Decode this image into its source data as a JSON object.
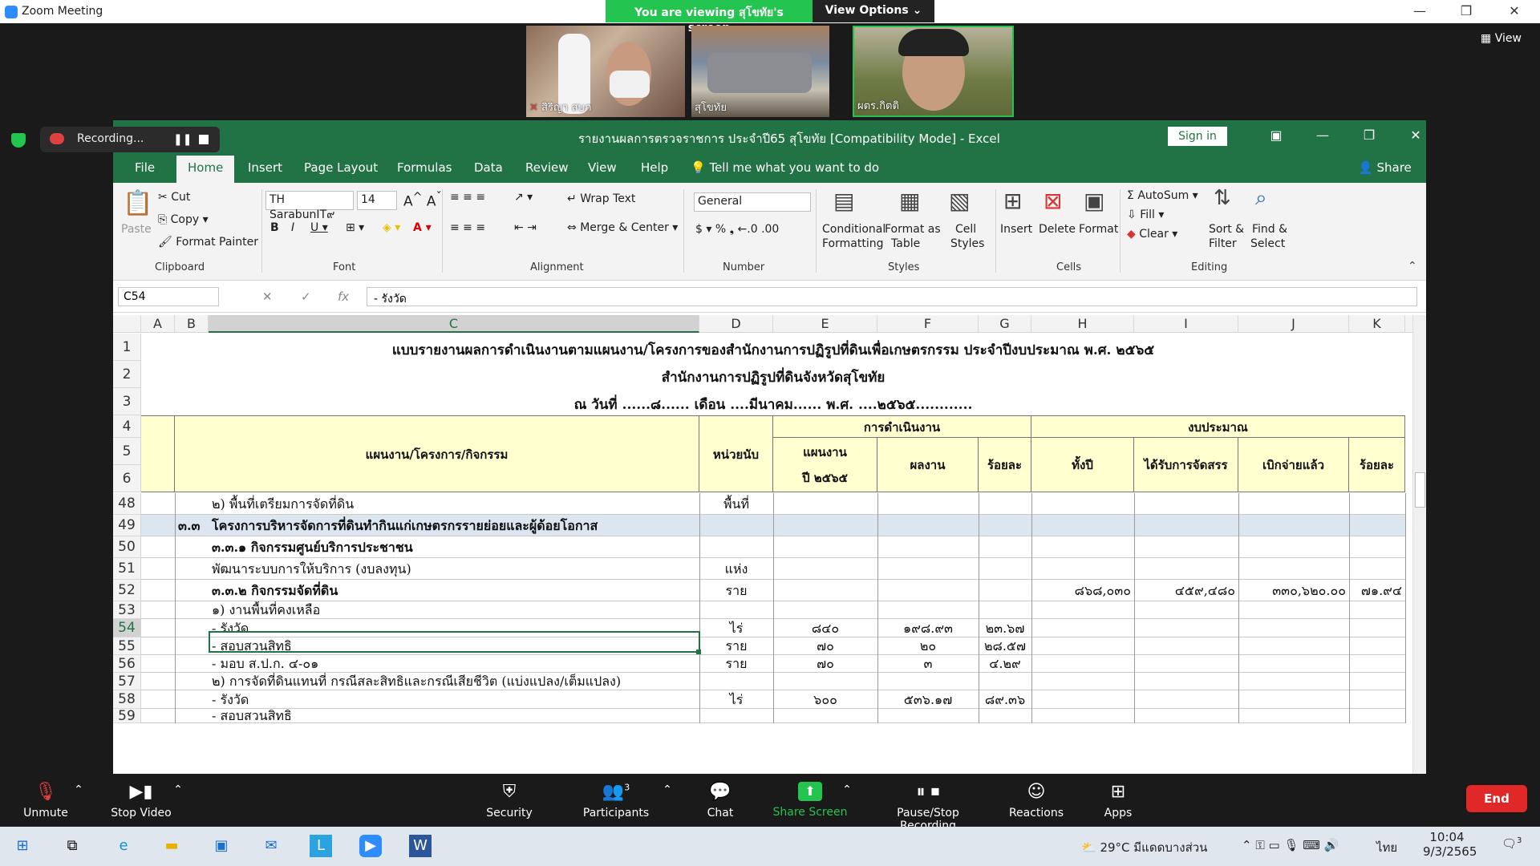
{
  "zoom": {
    "window_title": "Zoom Meeting",
    "viewing_label": "You are viewing สุโขทัย's screen",
    "view_options_label": "View Options ⌄",
    "view_button_label": "View",
    "participants": [
      {
        "name": "สิริญา สบภ"
      },
      {
        "name": "สุโขทัย"
      },
      {
        "name": "ผตร.กิตติ"
      }
    ],
    "recording_label": "Recording...",
    "toolbar": {
      "unmute": "Unmute",
      "stop_video": "Stop Video",
      "security": "Security",
      "participants": "Participants",
      "participants_count": "3",
      "chat": "Chat",
      "share_screen": "Share Screen",
      "pause_stop_recording": "Pause/Stop Recording",
      "reactions": "Reactions",
      "apps": "Apps",
      "end": "End"
    }
  },
  "excel": {
    "title": "รายงานผลการตรวจราชการ ประจำปี65 สุโขทัย  [Compatibility Mode]  -  Excel",
    "sign_in": "Sign in",
    "tabs": [
      "File",
      "Home",
      "Insert",
      "Page Layout",
      "Formulas",
      "Data",
      "Review",
      "View",
      "Help"
    ],
    "tell_me": "Tell me what you want to do",
    "share": "Share",
    "ribbon": {
      "paste": "Paste",
      "cut": "Cut",
      "copy": "Copy",
      "format_painter": "Format Painter",
      "clipboard": "Clipboard",
      "font_name": "TH SarabunIT๙",
      "font_size": "14",
      "font": "Font",
      "wrap_text": "Wrap Text",
      "merge_center": "Merge & Center",
      "alignment": "Alignment",
      "number_format": "General",
      "number": "Number",
      "conditional_formatting_1": "Conditional",
      "conditional_formatting_2": "Formatting",
      "format_as_table_1": "Format as",
      "format_as_table_2": "Table",
      "cell_styles_1": "Cell",
      "cell_styles_2": "Styles",
      "styles": "Styles",
      "insert": "Insert",
      "delete": "Delete",
      "format": "Format",
      "cells": "Cells",
      "autosum": "AutoSum",
      "fill": "Fill",
      "clear": "Clear",
      "sort_filter_1": "Sort &",
      "sort_filter_2": "Filter",
      "find_select_1": "Find &",
      "find_select_2": "Select",
      "editing": "Editing"
    },
    "name_box": "C54",
    "formula": "       - รังวัด",
    "columns": [
      "A",
      "B",
      "C",
      "D",
      "E",
      "F",
      "G",
      "H",
      "I",
      "J",
      "K"
    ],
    "sheet_title_1": "แบบรายงานผลการดำเนินงานตามแผนงาน/โครงการของสำนักงานการปฏิรูปที่ดินเพื่อเกษตรกรรม ประจำปีงบประมาณ พ.ศ. ๒๕๖๕",
    "sheet_title_2": "สำนักงานการปฏิรูปที่ดินจังหวัดสุโขทัย",
    "sheet_title_3": "ณ วันที่ ......๘......  เดือน ....มีนาคม......  พ.ศ.  ....๒๕๖๕............",
    "headers": {
      "plan": "แผนงาน/โครงการ/กิจกรรม",
      "unit": "หน่วยนับ",
      "operation": "การดำเนินงาน",
      "budget": "งบประมาณ",
      "plan_year_1": "แผนงาน",
      "plan_year_2": "ปี ๒๕๖๕",
      "result": "ผลงาน",
      "percent": "ร้อยละ",
      "whole_year": "ทั้งปี",
      "allocated": "ได้รับการจัดสรร",
      "disbursed": "เบิกจ่ายแล้ว",
      "percent2": "ร้อยละ"
    },
    "header_rows": [
      "1",
      "2",
      "3",
      "4",
      "5",
      "6"
    ],
    "rows": [
      {
        "num": "48",
        "c": "       ๒) พื้นที่เตรียมการจัดที่ดิน",
        "d": "พื้นที่",
        "e": "",
        "f": "",
        "g": "",
        "h": "",
        "i": "",
        "j": "",
        "k": ""
      },
      {
        "num": "49",
        "b": "๓.๓",
        "c": "โครงการบริหารจัดการที่ดินทำกินแก่เกษตรกรรายย่อยและผู้ด้อยโอกาส",
        "d": "",
        "e": "",
        "f": "",
        "g": "",
        "h": "",
        "i": "",
        "j": "",
        "k": ""
      },
      {
        "num": "50",
        "c": "    ๓.๓.๑ กิจกรรมศูนย์บริการประชาชน",
        "d": "",
        "e": "",
        "f": "",
        "g": "",
        "h": "",
        "i": "",
        "j": "",
        "k": ""
      },
      {
        "num": "51",
        "c": "          พัฒนาระบบการให้บริการ (งบลงทุน)",
        "d": "แห่ง",
        "e": "",
        "f": "",
        "g": "",
        "h": "",
        "i": "",
        "j": "",
        "k": ""
      },
      {
        "num": "52",
        "c": "    ๓.๓.๒ กิจกรรมจัดที่ดิน",
        "d": "ราย",
        "e": "",
        "f": "",
        "g": "",
        "h": "๘๖๘,๐๓๐",
        "i": "๔๕๙,๔๘๐",
        "j": "๓๓๐,๖๒๐.๐๐",
        "k": "๗๑.๙๔"
      },
      {
        "num": "53",
        "c": "          ๑) งานพื้นที่คงเหลือ",
        "d": "",
        "e": "",
        "f": "",
        "g": "",
        "h": "",
        "i": "",
        "j": "",
        "k": ""
      },
      {
        "num": "54",
        "c": "              - รังวัด",
        "d": "ไร่",
        "e": "๘๔๐",
        "f": "๑๙๘.๙๓",
        "g": "๒๓.๖๗",
        "h": "",
        "i": "",
        "j": "",
        "k": ""
      },
      {
        "num": "55",
        "c": "              - สอบสวนสิทธิ",
        "d": "ราย",
        "e": "๗๐",
        "f": "๒๐",
        "g": "๒๘.๕๗",
        "h": "",
        "i": "",
        "j": "",
        "k": ""
      },
      {
        "num": "56",
        "c": "              - มอบ ส.ป.ก. ๔-๐๑",
        "d": "ราย",
        "e": "๗๐",
        "f": "๓",
        "g": "๔.๒๙",
        "h": "",
        "i": "",
        "j": "",
        "k": ""
      },
      {
        "num": "57",
        "c": "          ๒) การจัดที่ดินแทนที่ กรณีสละสิทธิและกรณีเสียชีวิต   (แบ่งแปลง/เต็มแปลง)",
        "d": "",
        "e": "",
        "f": "",
        "g": "",
        "h": "",
        "i": "",
        "j": "",
        "k": ""
      },
      {
        "num": "58",
        "c": "              - รังวัด",
        "d": "ไร่",
        "e": "๖๐๐",
        "f": "๕๓๖.๑๗",
        "g": "๘๙.๓๖",
        "h": "",
        "i": "",
        "j": "",
        "k": ""
      },
      {
        "num": "59",
        "c": "              - สอบสวนสิทธิ",
        "d": "",
        "e": "",
        "f": "",
        "g": "",
        "h": "",
        "i": "",
        "j": "",
        "k": ""
      }
    ]
  },
  "taskbar": {
    "weather": "29°C  มีแดดบางส่วน",
    "lang": "ไทย",
    "time": "10:04",
    "date": "9/3/2565",
    "notifications": "3"
  }
}
